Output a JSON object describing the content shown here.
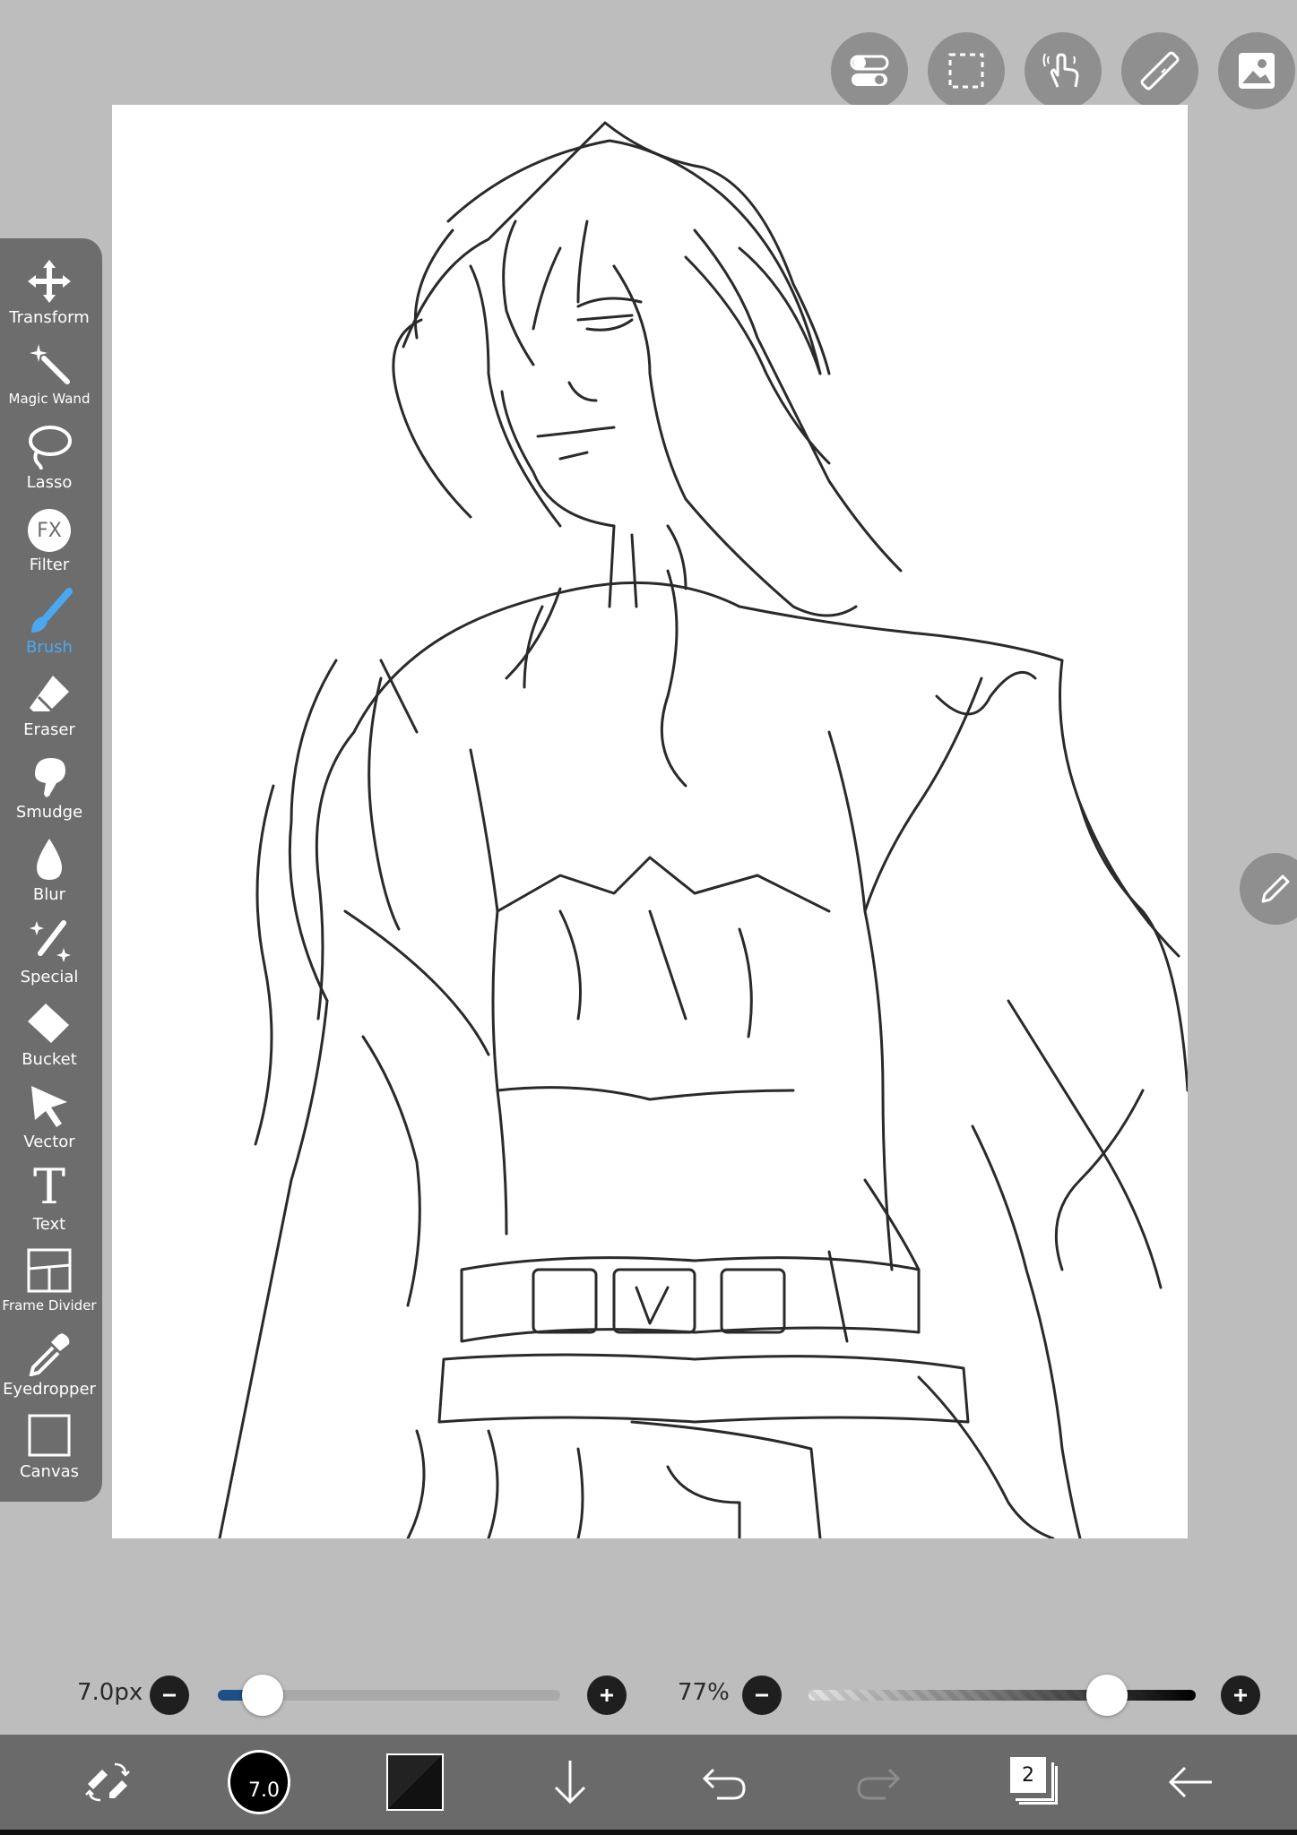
{
  "top_toolbar": {
    "icons": [
      "toggle-icon",
      "selection-icon",
      "gesture-icon",
      "ruler-icon",
      "image-icon"
    ]
  },
  "tools": [
    {
      "label": "Transform",
      "icon": "move-arrows-icon",
      "active": false
    },
    {
      "label": "Magic Wand",
      "icon": "magic-wand-icon",
      "active": false
    },
    {
      "label": "Lasso",
      "icon": "lasso-icon",
      "active": false
    },
    {
      "label": "Filter",
      "icon": "fx-icon",
      "active": false
    },
    {
      "label": "Brush",
      "icon": "brush-icon",
      "active": true
    },
    {
      "label": "Eraser",
      "icon": "eraser-icon",
      "active": false
    },
    {
      "label": "Smudge",
      "icon": "smudge-icon",
      "active": false
    },
    {
      "label": "Blur",
      "icon": "drop-icon",
      "active": false
    },
    {
      "label": "Special",
      "icon": "sparkle-pen-icon",
      "active": false
    },
    {
      "label": "Bucket",
      "icon": "bucket-icon",
      "active": false
    },
    {
      "label": "Vector",
      "icon": "cursor-arrow-icon",
      "active": false
    },
    {
      "label": "Text",
      "icon": "text-icon",
      "active": false
    },
    {
      "label": "Frame Divider",
      "icon": "frame-divider-icon",
      "active": false
    },
    {
      "label": "Eyedropper",
      "icon": "eyedropper-icon",
      "active": false
    },
    {
      "label": "Canvas",
      "icon": "canvas-icon",
      "active": false
    }
  ],
  "filter_icon_text": "FX",
  "text_icon_text": "T",
  "brush_size": {
    "label": "7.0px",
    "value": 7.0,
    "fraction": 0.13
  },
  "opacity": {
    "label": "77%",
    "fraction": 0.77
  },
  "bottom_bar": {
    "brush_size_badge": "7.0",
    "layer_count": "2"
  },
  "colors": {
    "background": "#bdbdbd",
    "toolbar": "#6d6d6d",
    "active_tool": "#4aa8f2",
    "bottom_bar": "#6a6a6a",
    "primary_color": "#000000"
  }
}
